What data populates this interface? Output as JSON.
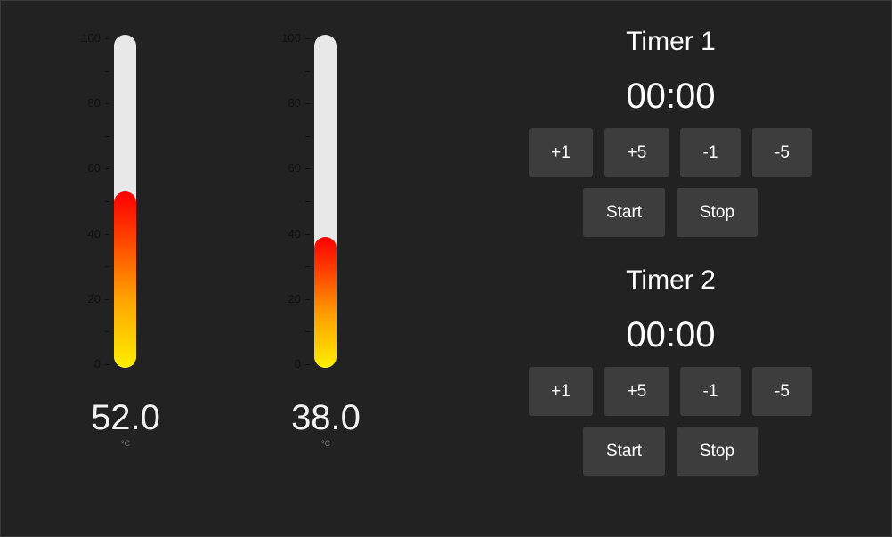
{
  "thermometers": [
    {
      "value": 52.0,
      "reading": "52.0",
      "unit": "°C",
      "scale_min": 0,
      "scale_max": 100,
      "major_ticks": [
        "0",
        "20",
        "40",
        "60",
        "80",
        "100"
      ]
    },
    {
      "value": 38.0,
      "reading": "38.0",
      "unit": "°C",
      "scale_min": 0,
      "scale_max": 100,
      "major_ticks": [
        "0",
        "20",
        "40",
        "60",
        "80",
        "100"
      ]
    }
  ],
  "timers": [
    {
      "title": "Timer 1",
      "display": "00:00",
      "buttons": {
        "plus1": "+1",
        "plus5": "+5",
        "minus1": "-1",
        "minus5": "-5",
        "start": "Start",
        "stop": "Stop"
      }
    },
    {
      "title": "Timer 2",
      "display": "00:00",
      "buttons": {
        "plus1": "+1",
        "plus5": "+5",
        "minus1": "-1",
        "minus5": "-5",
        "start": "Start",
        "stop": "Stop"
      }
    }
  ],
  "colors": {
    "background": "#222222",
    "button": "#3d3d3d",
    "tube": "#e8e8e8",
    "fill_bottom": "#ffef00",
    "fill_top": "#ff0000"
  }
}
